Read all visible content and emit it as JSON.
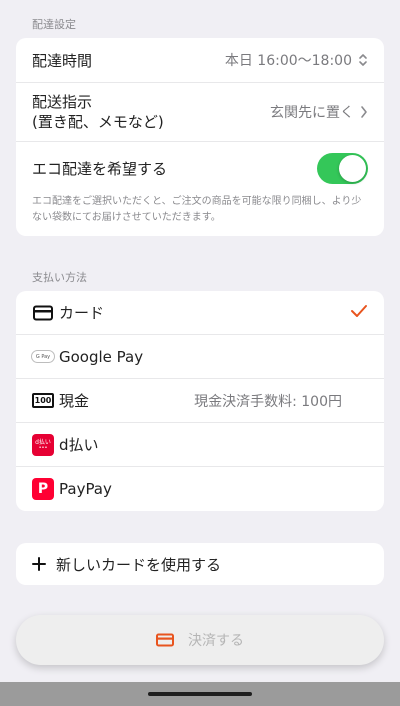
{
  "delivery": {
    "section_title": "配達設定",
    "time_label": "配達時間",
    "time_value": "本日 16:00〜18:00",
    "instruction_label_line1": "配送指示",
    "instruction_label_line2": "(置き配、メモなど)",
    "instruction_value": "玄関先に置く",
    "eco_label": "エコ配達を希望する",
    "eco_enabled": true,
    "eco_note": "エコ配達をご選択いただくと、ご注文の商品を可能な限り同梱し、より少ない袋数にてお届けさせていただきます。"
  },
  "payment": {
    "section_title": "支払い方法",
    "methods": [
      {
        "label": "カード",
        "icon": "credit-card-icon",
        "selected": true
      },
      {
        "label": "Google Pay",
        "icon": "google-pay-icon",
        "badge": "G Pay"
      },
      {
        "label": "現金",
        "icon": "cash-icon",
        "badge": "100",
        "fee": "現金決済手数料: 100円"
      },
      {
        "label": "d払い",
        "icon": "d-barai-icon",
        "badge": "d払い"
      },
      {
        "label": "PayPay",
        "icon": "paypay-icon",
        "badge": "P"
      }
    ]
  },
  "new_card": {
    "label": "新しいカードを使用する"
  },
  "checkout": {
    "label": "決済する"
  },
  "colors": {
    "accent": "#e8541e",
    "toggle_on": "#34c759",
    "background": "#f0eff4",
    "d_barai": "#e60033",
    "paypay": "#ff0033"
  }
}
